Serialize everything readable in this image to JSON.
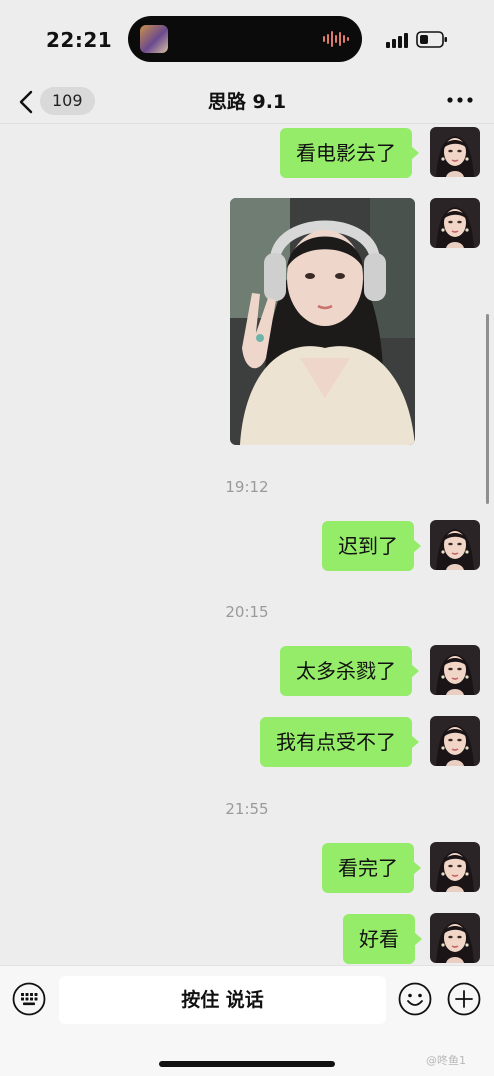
{
  "status_bar": {
    "time": "22:21"
  },
  "nav": {
    "unread_count": "109",
    "title": "思路 9.1"
  },
  "messages": [
    {
      "type": "text",
      "text": "看电影去了"
    },
    {
      "type": "image",
      "description": "photo"
    },
    {
      "type": "time",
      "text": "19:12"
    },
    {
      "type": "text",
      "text": "迟到了"
    },
    {
      "type": "time",
      "text": "20:15"
    },
    {
      "type": "text",
      "text": "太多杀戮了"
    },
    {
      "type": "text",
      "text": "我有点受不了"
    },
    {
      "type": "time",
      "text": "21:55"
    },
    {
      "type": "text",
      "text": "看完了"
    },
    {
      "type": "text",
      "text": "好看"
    }
  ],
  "input": {
    "hold_to_talk": "按住 说话"
  },
  "watermark": "@咚鱼1",
  "colors": {
    "bubble": "#95ec69",
    "background": "#ededed",
    "input_bar": "#f7f7f7"
  },
  "icons": [
    "back-chevron-icon",
    "more-icon",
    "keyboard-icon",
    "emoji-icon",
    "plus-icon",
    "signal-icon",
    "battery-icon",
    "audio-wave-icon"
  ]
}
